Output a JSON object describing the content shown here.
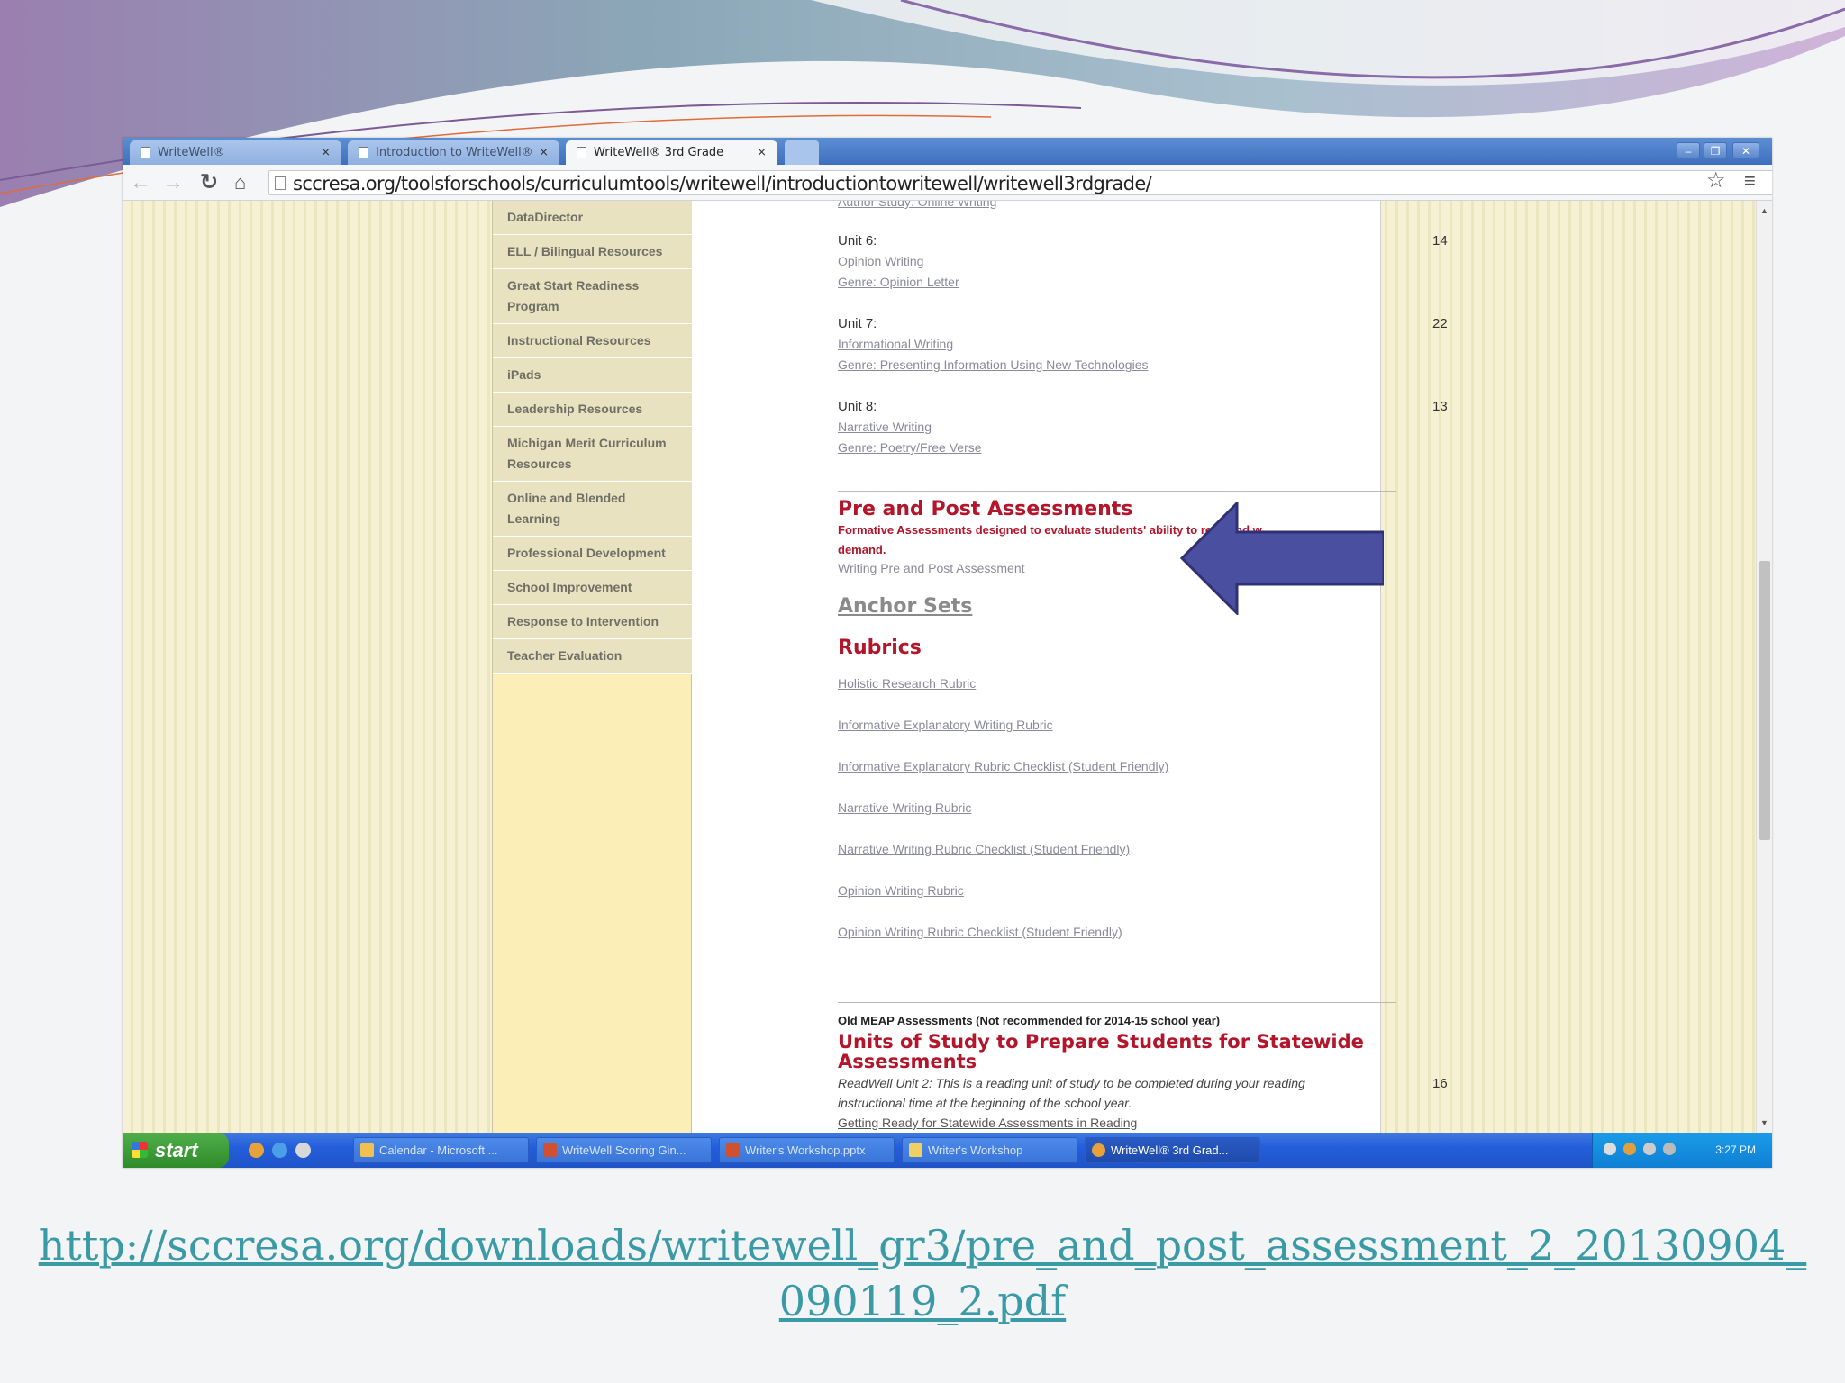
{
  "browser": {
    "tabs": [
      {
        "label": "WriteWell®",
        "active": false
      },
      {
        "label": "Introduction to WriteWell®",
        "active": false
      },
      {
        "label": "WriteWell® 3rd Grade",
        "active": true
      }
    ],
    "tab_close": "×",
    "url": "sccresa.org/toolsforschools/curriculumtools/writewell/introductiontowritewell/writewell3rdgrade/"
  },
  "sidebar": {
    "items": [
      "DataDirector",
      "ELL / Bilingual Resources",
      "Great Start Readiness Program",
      "Instructional Resources",
      "iPads",
      "Leadership Resources",
      "Michigan Merit Curriculum Resources",
      "Online and Blended Learning",
      "Professional Development",
      "School Improvement",
      "Response to Intervention",
      "Teacher Evaluation"
    ]
  },
  "content": {
    "cut_link": "Author Study: Online Writing",
    "units": [
      {
        "label": "Unit 6:",
        "num": "14",
        "link1": "Opinion Writing",
        "link2": "Genre: Opinion Letter"
      },
      {
        "label": "Unit 7:",
        "num": "22",
        "link1": "Informational Writing",
        "link2": "Genre: Presenting Information Using New Technologies"
      },
      {
        "label": "Unit 8:",
        "num": "13",
        "link1": "Narrative Writing",
        "link2": "Genre: Poetry/Free Verse"
      }
    ],
    "pre_post": {
      "heading": "Pre and Post Assessments",
      "desc_line1": "Formative Assessments designed to evaluate students' ability to read and w",
      "desc_line2": "demand.",
      "link": "Writing Pre and Post Assessment"
    },
    "anchor_sets": "Anchor Sets",
    "rubrics": {
      "heading": "Rubrics",
      "links": [
        "Holistic Research Rubric",
        "Informative Explanatory Writing Rubric",
        "Informative Explanatory Rubric Checklist (Student Friendly)",
        "Narrative Writing Rubric",
        "Narrative Writing Rubric Checklist (Student Friendly)",
        "Opinion Writing Rubric",
        "Opinion Writing Rubric Checklist (Student Friendly)"
      ]
    },
    "meap": {
      "note": "Old MEAP Assessments (Not recommended for 2014-15 school year)",
      "heading_line1": "Units of Study to Prepare Students for Statewide",
      "heading_line2": "Assessments",
      "desc_line1": "ReadWell Unit 2: This is a reading unit of study to be completed during your reading",
      "desc_line2": "instructional time at the beginning of the school year.",
      "num": "16",
      "link": "Getting Ready for Statewide Assessments in Reading"
    }
  },
  "taskbar": {
    "start": "start",
    "tasks": [
      {
        "label": "Calendar - Microsoft ...",
        "active": false
      },
      {
        "label": "WriteWell Scoring Gin...",
        "active": false
      },
      {
        "label": "Writer's Workshop.pptx",
        "active": false
      },
      {
        "label": "Writer's Workshop",
        "active": false
      },
      {
        "label": "WriteWell® 3rd Grad...",
        "active": true
      }
    ],
    "clock": "3:27 PM"
  },
  "caption": {
    "line1": "http://sccresa.org/downloads/writewell_gr3/pre_and_post_assessment_2_20130904_",
    "line2": "090119_2.pdf"
  },
  "colors": {
    "accent_red": "#b3152a",
    "arrow": "#4a4fa0",
    "caption_link": "#3a9aa6"
  }
}
